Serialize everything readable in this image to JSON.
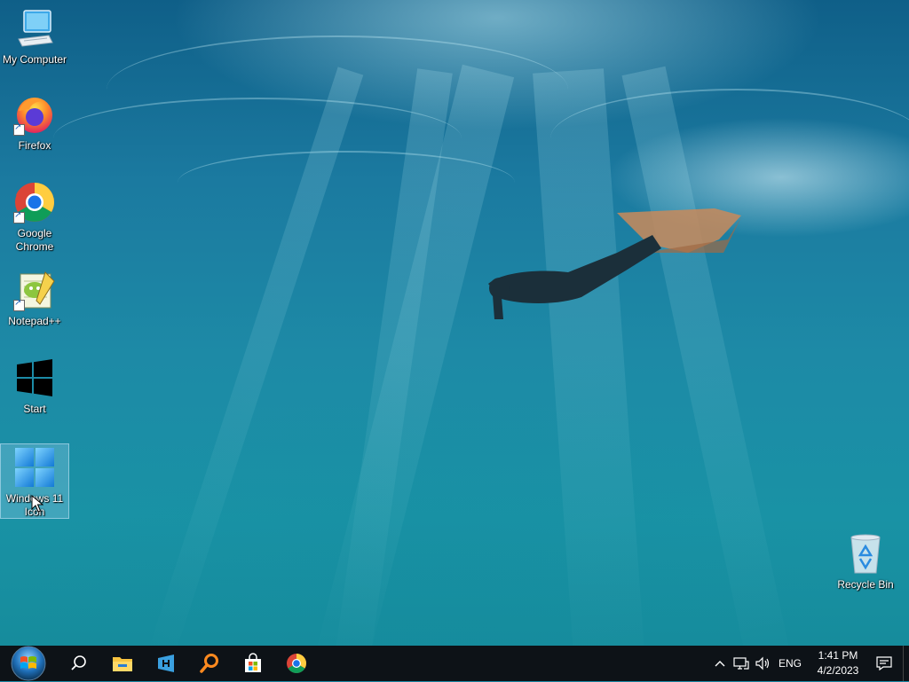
{
  "desktop": {
    "icons": [
      {
        "label": "My Computer",
        "icon": "computer-icon"
      },
      {
        "label": "Firefox",
        "icon": "firefox-icon"
      },
      {
        "label": "Google Chrome",
        "icon": "chrome-icon"
      },
      {
        "label": "Notepad++",
        "icon": "notepadpp-icon"
      },
      {
        "label": "Start",
        "icon": "windows-logo-icon"
      },
      {
        "label": "Windows 11 Icon",
        "icon": "windows11-logo-icon",
        "selected": true
      },
      {
        "label": "Recycle Bin",
        "icon": "recycle-bin-icon"
      }
    ]
  },
  "taskbar": {
    "buttons": [
      "start-orb",
      "search-icon",
      "file-explorer-icon",
      "app-icon",
      "search-app-icon",
      "store-icon",
      "chrome-icon"
    ],
    "tray": {
      "language": "ENG",
      "time": "1:41 PM",
      "date": "4/2/2023"
    }
  },
  "colors": {
    "taskbar": "#0d1217",
    "water_top": "#0f5f88",
    "water_bottom": "#168c9c",
    "selection": "#8cc8e6"
  }
}
